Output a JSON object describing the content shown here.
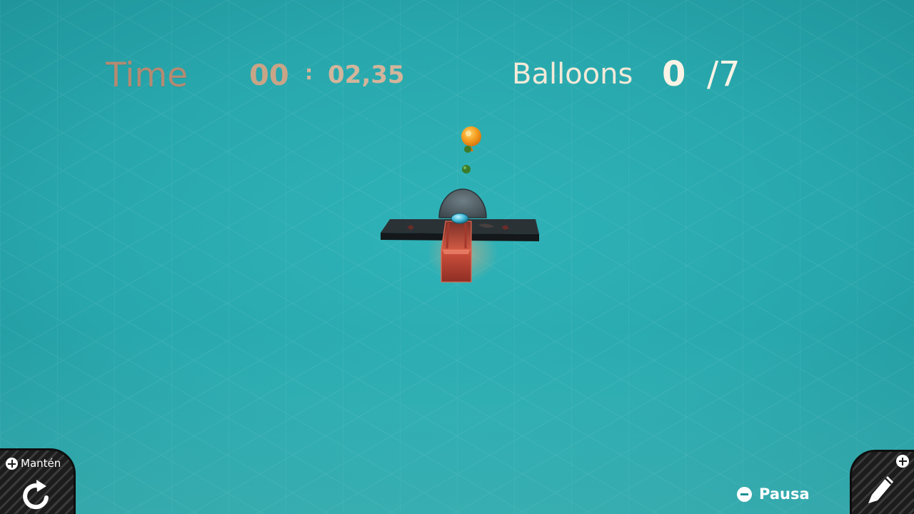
{
  "hud": {
    "time_label": "Time",
    "time_minutes": "00",
    "time_separator": ":",
    "time_seconds": "02,35",
    "balloons_label": "Balloons",
    "balloons_count": "0",
    "balloons_total": "/7"
  },
  "controls": {
    "hold_label": "Mantén",
    "hold_icon": "restart-icon",
    "pause_label": "Pausa",
    "pause_icon": "minus-button-icon",
    "edit_icon": "pencil-icon",
    "plus_icon": "plus-button-icon"
  },
  "scene": {
    "objects": [
      "balloon",
      "marble-ball",
      "platform",
      "ramp",
      "dome"
    ]
  },
  "colors": {
    "background": "#28a8ad",
    "time_color": "#b48a72",
    "balloons_color": "#f4e9d8",
    "balloon": "#f29a1c",
    "ramp": "#c8483a",
    "platform": "#2a2f33"
  }
}
